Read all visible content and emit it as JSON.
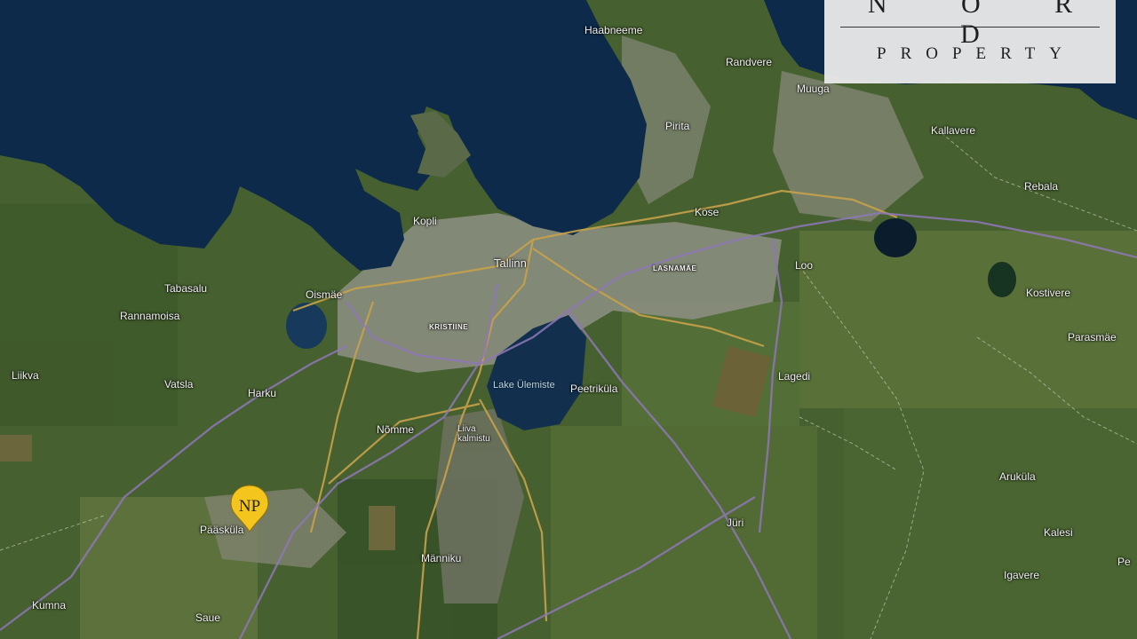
{
  "logo": {
    "top_text": "N O R D",
    "bottom_text": "PROPERTY"
  },
  "marker": {
    "icon": "np-location-pin-icon",
    "text": "NP",
    "color": "#f4c51d"
  },
  "places": [
    {
      "name": "Haabneeme"
    },
    {
      "name": "Randvere"
    },
    {
      "name": "Muuga"
    },
    {
      "name": "Pirita"
    },
    {
      "name": "Kallavere"
    },
    {
      "name": "Rebala"
    },
    {
      "name": "Kose"
    },
    {
      "name": "Kopli"
    },
    {
      "name": "Tallinn"
    },
    {
      "name": "Loo"
    },
    {
      "name": "Oismäe"
    },
    {
      "name": "Tabasalu"
    },
    {
      "name": "Rannamoisa"
    },
    {
      "name": "Kostivere"
    },
    {
      "name": "Parasmäe"
    },
    {
      "name": "Liikva"
    },
    {
      "name": "Vatsla"
    },
    {
      "name": "Harku"
    },
    {
      "name": "Peetriküla"
    },
    {
      "name": "Lagedi"
    },
    {
      "name": "Nõmme"
    },
    {
      "name": "Liiva kalmistu"
    },
    {
      "name": "Aruküla"
    },
    {
      "name": "Pääsküla"
    },
    {
      "name": "Jüri"
    },
    {
      "name": "Kalesi"
    },
    {
      "name": "Männiku"
    },
    {
      "name": "Igavere"
    },
    {
      "name": "Kumna"
    },
    {
      "name": "Saue"
    },
    {
      "name": "Pe"
    }
  ],
  "districts": [
    {
      "name": "LASNAMÄE"
    },
    {
      "name": "KRISTIINE"
    }
  ],
  "lakes": [
    {
      "name": "Lake Ülemiste"
    }
  ]
}
